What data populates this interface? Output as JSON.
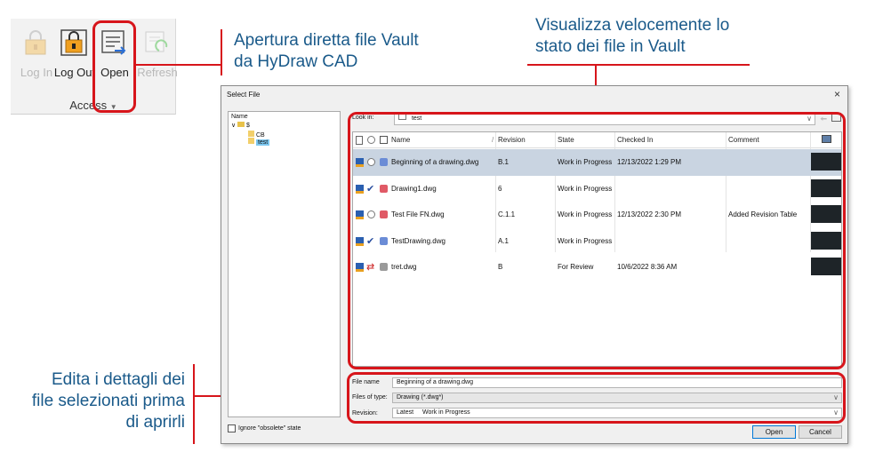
{
  "ribbon": {
    "buttons": [
      {
        "label": "Log In",
        "enabled": false,
        "icon": "lock-icon"
      },
      {
        "label": "Log Out",
        "enabled": true,
        "icon": "lock-icon"
      },
      {
        "label": "Open",
        "enabled": true,
        "icon": "open-file-icon"
      },
      {
        "label": "Refresh",
        "enabled": false,
        "icon": "refresh-icon"
      }
    ],
    "group_label": "Access"
  },
  "callouts": {
    "open_line1": "Apertura diretta file Vault",
    "open_line2": "da HyDraw CAD",
    "grid_line1": "Visualizza velocemente lo",
    "grid_line2": "stato dei file in Vault",
    "fields_line1": "Edita i dettagli dei",
    "fields_line2": "file selezionati prima",
    "fields_line3": "di aprirli"
  },
  "dialog": {
    "title": "Select File",
    "close": "×",
    "tree_header": "Name",
    "tree_root": "$",
    "tree_items": [
      "CB",
      "test"
    ],
    "look_in_label": "Look in:",
    "look_in_value": "test",
    "columns": [
      "Name",
      "Revision",
      "State",
      "Checked In",
      "Comment"
    ],
    "rows": [
      {
        "name": "Beginning of a drawing.dwg",
        "revision": "B.1",
        "state": "Work in Progress",
        "checked_in": "12/13/2022 1:29 PM",
        "comment": "",
        "selected": true,
        "checked": false,
        "status_color": "#6b8cd6"
      },
      {
        "name": "Drawing1.dwg",
        "revision": "6",
        "state": "Work in Progress",
        "checked_in": "",
        "comment": "",
        "selected": false,
        "checked": true,
        "status_color": "#e05a66"
      },
      {
        "name": "Test File FN.dwg",
        "revision": "C.1.1",
        "state": "Work in Progress",
        "checked_in": "12/13/2022 2:30 PM",
        "comment": "Added Revision Table",
        "selected": false,
        "checked": false,
        "status_color": "#e05a66"
      },
      {
        "name": "TestDrawing.dwg",
        "revision": "A.1",
        "state": "Work in Progress",
        "checked_in": "",
        "comment": "",
        "selected": false,
        "checked": true,
        "status_color": "#6b8cd6"
      },
      {
        "name": "tret.dwg",
        "revision": "B",
        "state": "For Review",
        "checked_in": "10/6/2022 8:36 AM",
        "comment": "",
        "selected": false,
        "checked": false,
        "status_color": "#9a9a9a"
      }
    ],
    "file_name_label": "File name",
    "file_name_value": "Beginning of a drawing.dwg",
    "files_of_type_label": "Files of type:",
    "files_of_type_value": "Drawing (*.dwg*)",
    "revision_label": "Revision:",
    "revision_value_1": "Latest",
    "revision_value_2": "Work in Progress",
    "ignore_obsolete": "Ignore \"obsolete\" state",
    "open_button": "Open",
    "cancel_button": "Cancel"
  },
  "colors": {
    "accent": "#d7151b",
    "callout_text": "#1a5a8a",
    "selected_row": "#c9d4e1"
  }
}
